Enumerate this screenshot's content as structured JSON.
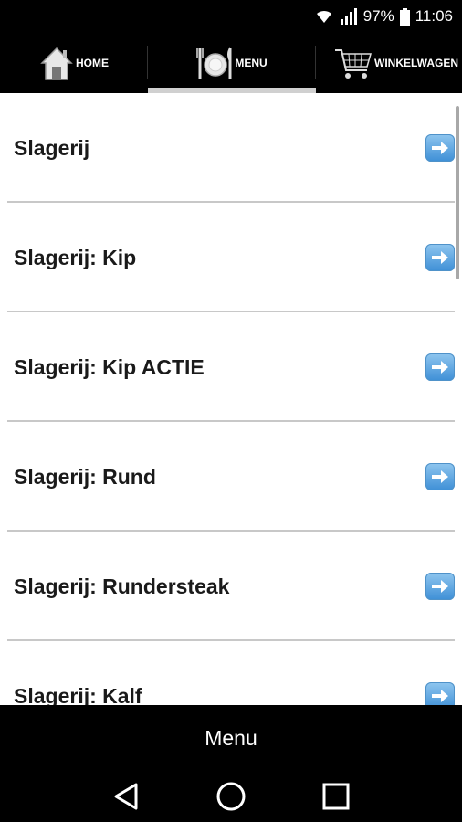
{
  "status_bar": {
    "battery": "97%",
    "time": "11:06"
  },
  "tabs": [
    {
      "label": "HOME",
      "icon": "home-icon"
    },
    {
      "label": "MENU",
      "icon": "plate-cutlery-icon",
      "active": true
    },
    {
      "label": "WINKELWAGEN",
      "icon": "shopping-cart-icon"
    }
  ],
  "list": {
    "items": [
      {
        "label": "Slagerij"
      },
      {
        "label": "Slagerij: Kip"
      },
      {
        "label": "Slagerij: Kip ACTIE"
      },
      {
        "label": "Slagerij: Rund"
      },
      {
        "label": "Slagerij: Rundersteak"
      },
      {
        "label": "Slagerij: Kalf"
      }
    ]
  },
  "bottom_bar": {
    "label": "Menu"
  },
  "nav": {
    "buttons": [
      "back-icon",
      "home-circle-icon",
      "recents-icon"
    ]
  }
}
